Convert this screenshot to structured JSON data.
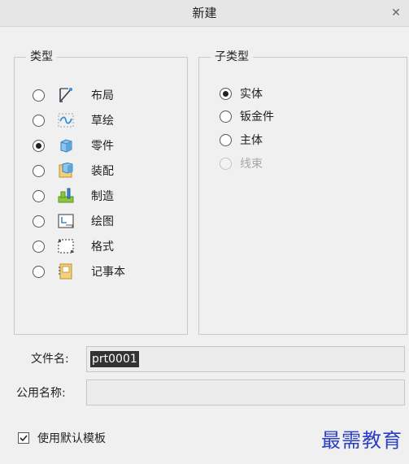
{
  "window": {
    "title": "新建",
    "close_glyph": "✕"
  },
  "type_group": {
    "legend": "类型",
    "selected": "零件",
    "items": [
      {
        "label": "布局",
        "icon": "layout-icon"
      },
      {
        "label": "草绘",
        "icon": "sketch-icon"
      },
      {
        "label": "零件",
        "icon": "part-icon"
      },
      {
        "label": "装配",
        "icon": "assembly-icon"
      },
      {
        "label": "制造",
        "icon": "manufacturing-icon"
      },
      {
        "label": "绘图",
        "icon": "drawing-icon"
      },
      {
        "label": "格式",
        "icon": "format-icon"
      },
      {
        "label": "记事本",
        "icon": "notebook-icon"
      }
    ]
  },
  "subtype_group": {
    "legend": "子类型",
    "selected": "实体",
    "items": [
      {
        "label": "实体",
        "enabled": true
      },
      {
        "label": "钣金件",
        "enabled": true
      },
      {
        "label": "主体",
        "enabled": true
      },
      {
        "label": "线束",
        "enabled": false
      }
    ]
  },
  "filename": {
    "label": "文件名:",
    "value": "prt0001"
  },
  "common_name": {
    "label": "公用名称:",
    "value": ""
  },
  "use_default_template": {
    "label": "使用默认模板",
    "checked": true
  },
  "watermark": {
    "text": "最需教育"
  },
  "colors": {
    "accent": "#3a8ed6",
    "watermark": "#2a3fc4"
  }
}
